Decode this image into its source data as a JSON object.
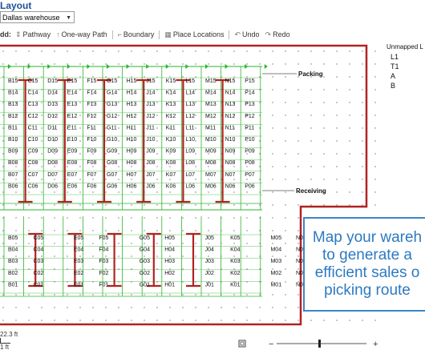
{
  "window": {
    "title": "Layout"
  },
  "warehouse_select": {
    "value": "Dallas warehouse"
  },
  "toolbar": {
    "lead": "dd:",
    "pathway": "Pathway",
    "one_way_path": "One-way Path",
    "boundary": "Boundary",
    "place_locations": "Place Locations",
    "undo": "Undo",
    "redo": "Redo"
  },
  "map": {
    "packing_label": "Packing",
    "receiving_label": "Receiving",
    "top_columns": [
      "B",
      "C",
      "D",
      "E",
      "F",
      "G",
      "H",
      "J",
      "K",
      "L",
      "M",
      "N",
      "P"
    ],
    "top_numbers": [
      "15",
      "14",
      "13",
      "12",
      "11",
      "10",
      "09",
      "08",
      "07",
      "06"
    ],
    "bottom_columns": [
      "B",
      "C",
      "E",
      "F",
      "G",
      "H",
      "J",
      "K",
      "M",
      "N"
    ],
    "bottom_numbers": [
      "05",
      "04",
      "03",
      "02",
      "01"
    ],
    "wall_color": "#b22222",
    "path_color": "#2db52d"
  },
  "unmapped": {
    "title": "Unmapped L",
    "items": [
      "L1",
      "T1",
      "A",
      "B"
    ]
  },
  "promo": {
    "lines": [
      "Map your wareh",
      "to generate a",
      "efficient sales o",
      "picking route"
    ]
  },
  "scale": {
    "label": "22.3 ft",
    "sub": "1 ft"
  }
}
